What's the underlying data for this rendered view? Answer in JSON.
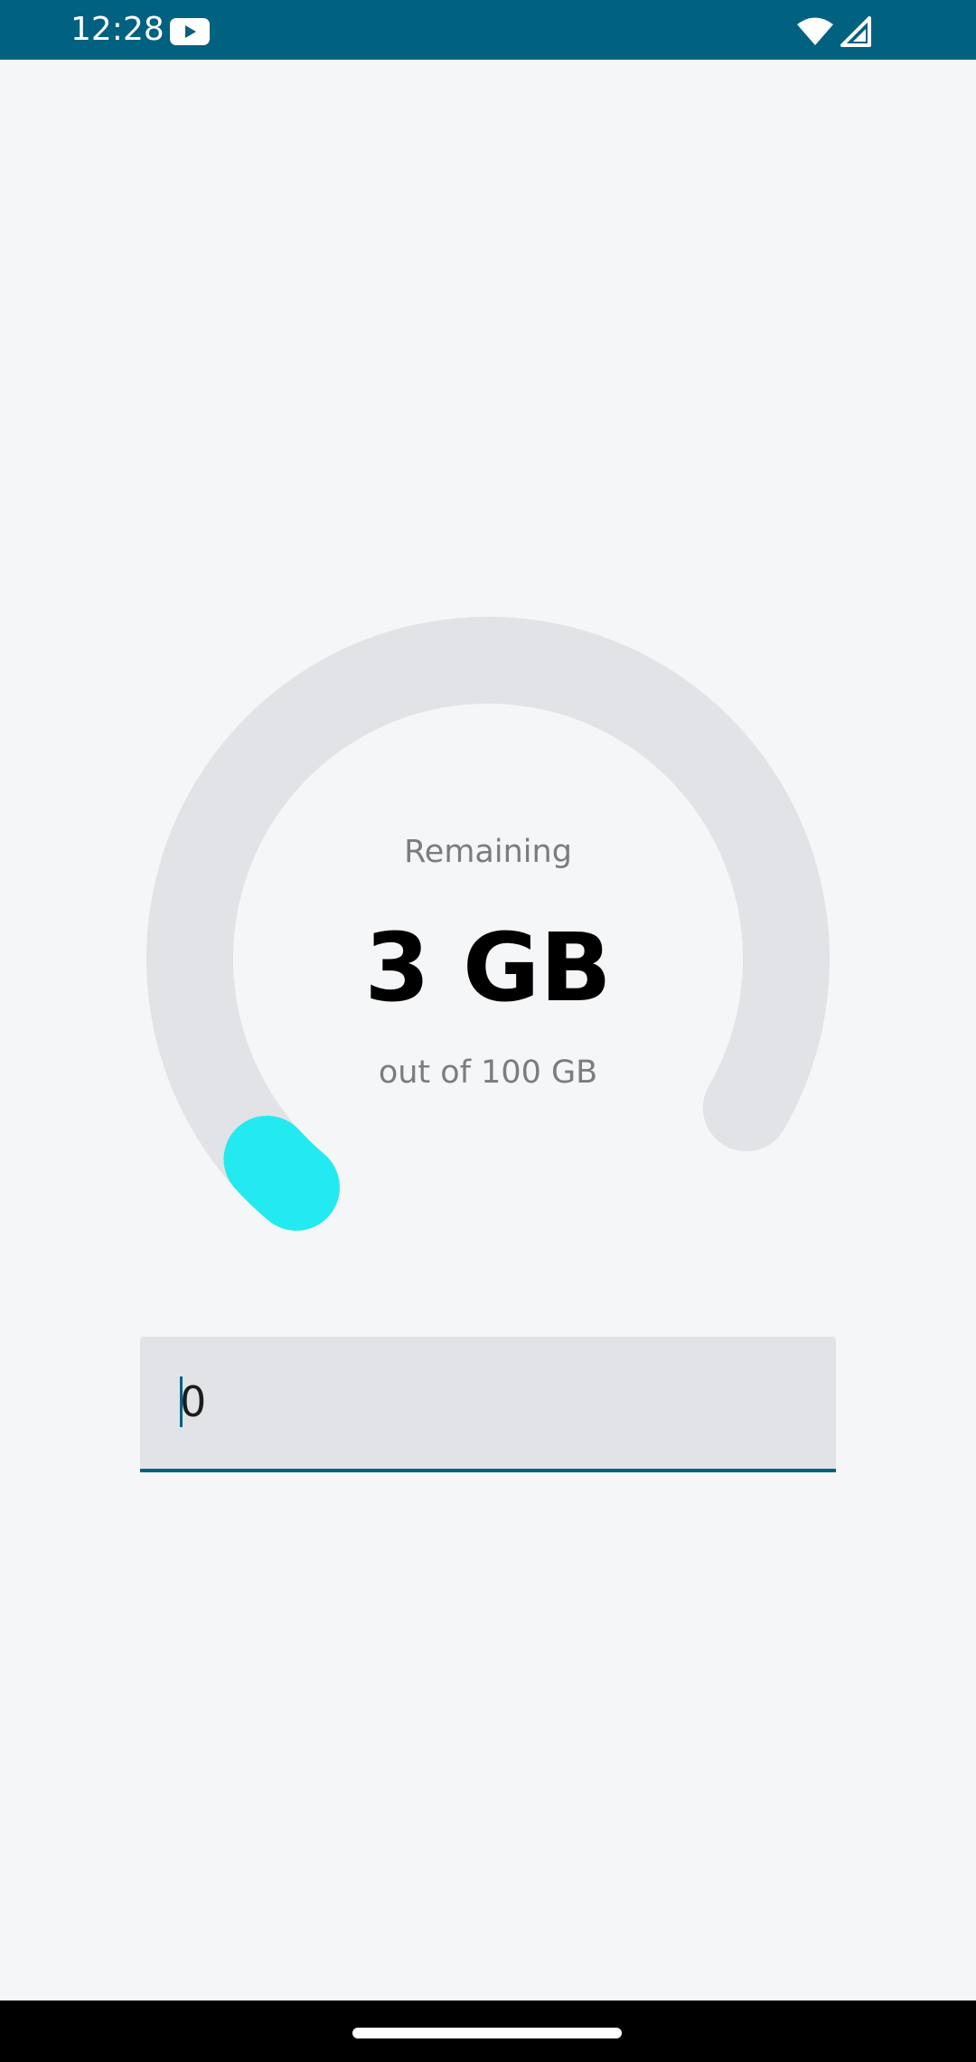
{
  "status_bar": {
    "time": "12:28",
    "icons": [
      "youtube-icon",
      "wifi-icon",
      "cell-signal-icon"
    ],
    "background": "#006180"
  },
  "gauge": {
    "caption": "Remaining",
    "value": "3 GB",
    "total": "out of 100 GB",
    "remaining_fraction": 0.03,
    "track_color": "#e1e3e6",
    "progress_color": "#22eaf0"
  },
  "text_field": {
    "value": "0"
  },
  "nav_bar": {
    "handle": "gesture-handle"
  }
}
